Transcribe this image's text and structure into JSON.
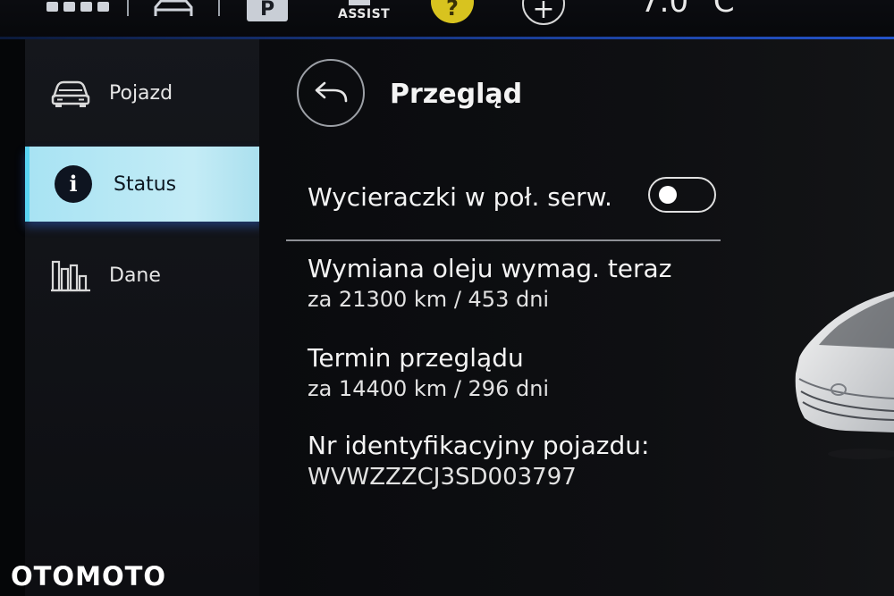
{
  "statusbar": {
    "assist_label": "ASSIST",
    "parking_label": "P",
    "help_label": "?",
    "add_label": "+",
    "temperature": "7.0 °C"
  },
  "sidebar": {
    "items": [
      {
        "label": "Pojazd",
        "icon": "car-icon",
        "active": false
      },
      {
        "label": "Status",
        "icon": "info-icon",
        "active": true
      },
      {
        "label": "Dane",
        "icon": "bar-chart-icon",
        "active": false
      }
    ]
  },
  "main": {
    "title": "Przegląd",
    "wipers_label": "Wycieraczki w poł. serw.",
    "wipers_enabled": false,
    "oil": {
      "title": "Wymiana oleju wymag. teraz",
      "value": "za 21300 km / 453 dni"
    },
    "inspection": {
      "title": "Termin przeglądu",
      "value": "za 14400 km / 296 dni"
    },
    "vin": {
      "title": "Nr identyfikacyjny pojazdu:",
      "value": "WVWZZZCJ3SD003797"
    }
  },
  "watermark": "OTOMOTO",
  "colors": {
    "active_item": "#c4ecf6",
    "accent_blue": "#2453c9",
    "help_yellow": "#d8c31f"
  }
}
